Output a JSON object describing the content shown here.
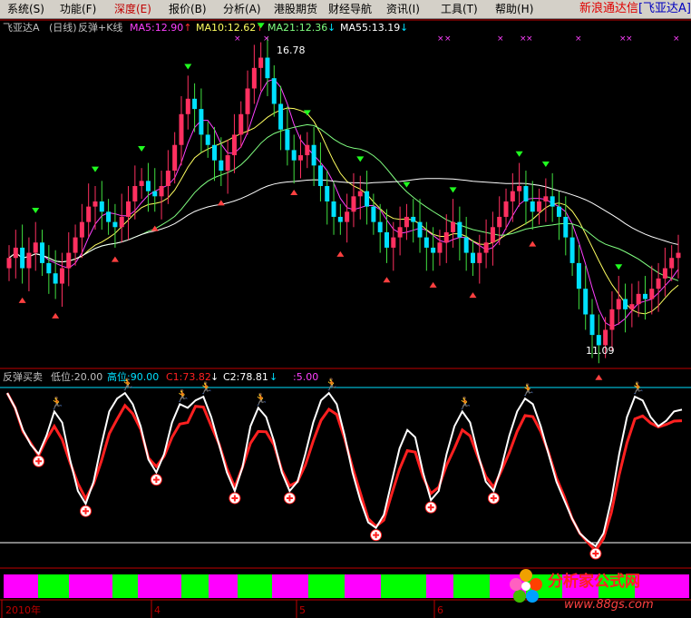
{
  "menu": {
    "items": [
      "系统(S)",
      "功能(F)",
      "深度(E)",
      "报价(B)",
      "分析(A)",
      "港股期货",
      "财经导航",
      "资讯(I)",
      "工具(T)",
      "帮助(H)"
    ],
    "active_index": 2,
    "brand": "新浪通达信",
    "brand_stock": "[飞亚达A]"
  },
  "main_header": {
    "stock": "飞亚达A",
    "period": "(日线)",
    "indicator": "反弹+K线",
    "ma": [
      {
        "label": "MA5:12.90",
        "arrow": "↑",
        "color": "#ff40ff"
      },
      {
        "label": "MA10:12.62",
        "arrow": "↑",
        "color": "#ffff60"
      },
      {
        "label": "MA21:12.36",
        "arrow": "↓",
        "color": "#80ff80"
      },
      {
        "label": "MA55:13.19",
        "arrow": "↓",
        "color": "#ffffff"
      }
    ]
  },
  "price_labels": {
    "high": "16.78",
    "low": "11.09"
  },
  "sub_header": {
    "name": "反弹买卖",
    "low_label": "低位:20.00",
    "high_label": "高位:90.00",
    "c1": "C1:73.82",
    "c1_arrow": "↓",
    "c2": "C2:78.81",
    "c2_arrow": "↓",
    "extra": ":5.00"
  },
  "x_axis": {
    "labels": [
      "2010年",
      "4",
      "5",
      "6"
    ]
  },
  "watermark": {
    "title": "分析家公式网",
    "url": "www.88gs.com"
  },
  "colors": {
    "up": "#ff3060",
    "down": "#00e0ff",
    "ma5": "#ff40ff",
    "ma10": "#ffff60",
    "ma21": "#80ff80",
    "ma55": "#ffffff",
    "c1": "#ff2020",
    "c2": "#ffffff",
    "grid": "#c00000"
  },
  "chart_data": {
    "type": "candlestick",
    "price_range": [
      11.09,
      16.78
    ],
    "close_series": [
      12.8,
      13.0,
      12.6,
      12.9,
      13.1,
      12.7,
      12.5,
      12.3,
      12.6,
      12.9,
      13.2,
      13.5,
      13.8,
      13.9,
      13.7,
      13.5,
      13.4,
      13.6,
      13.9,
      14.2,
      14.3,
      14.1,
      14.0,
      14.2,
      14.5,
      15.0,
      15.6,
      15.9,
      15.7,
      15.2,
      15.0,
      14.7,
      14.5,
      14.8,
      15.2,
      15.6,
      16.1,
      16.5,
      16.7,
      16.3,
      15.8,
      15.3,
      14.9,
      14.7,
      14.8,
      15.0,
      14.6,
      14.2,
      13.9,
      13.6,
      13.5,
      13.7,
      14.0,
      14.1,
      13.8,
      13.5,
      13.3,
      13.0,
      13.2,
      13.4,
      13.6,
      13.5,
      13.2,
      13.0,
      12.9,
      13.1,
      13.3,
      13.5,
      13.2,
      12.9,
      12.7,
      12.9,
      13.1,
      13.4,
      13.6,
      13.9,
      14.1,
      14.2,
      13.9,
      13.7,
      13.9,
      14.0,
      13.8,
      13.6,
      13.2,
      12.7,
      12.2,
      11.7,
      11.3,
      11.1,
      11.4,
      11.8,
      12.0,
      11.8,
      11.9,
      12.1,
      12.0,
      12.2,
      12.4,
      12.6,
      12.8,
      12.9
    ],
    "oscillator": {
      "low_line": 20.0,
      "high_line": 90.0,
      "c1_last": 73.82,
      "c2_last": 78.81,
      "c2_series": [
        88,
        80,
        68,
        60,
        55,
        65,
        78,
        72,
        52,
        35,
        28,
        40,
        60,
        78,
        85,
        88,
        82,
        70,
        52,
        45,
        55,
        72,
        82,
        80,
        84,
        86,
        75,
        60,
        45,
        35,
        48,
        70,
        80,
        75,
        62,
        45,
        35,
        40,
        55,
        72,
        84,
        88,
        82,
        65,
        45,
        30,
        18,
        15,
        22,
        40,
        58,
        68,
        64,
        45,
        30,
        35,
        55,
        70,
        78,
        72,
        55,
        40,
        35,
        48,
        65,
        78,
        85,
        82,
        70,
        55,
        40,
        30,
        20,
        12,
        8,
        5,
        12,
        30,
        55,
        75,
        86,
        84,
        75,
        70,
        73,
        78,
        79
      ]
    }
  }
}
